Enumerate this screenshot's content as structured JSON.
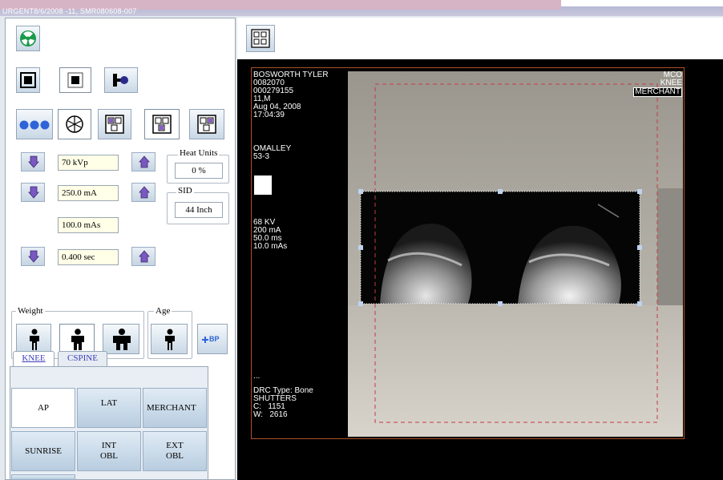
{
  "window": {
    "title": "URGENT8/6/2008 -11, SMR080608-007"
  },
  "exposure": {
    "kvp": "70 kVp",
    "ma": "250.0 mA",
    "mas": "100.0 mAs",
    "time": "0.400 sec"
  },
  "heat_units": {
    "label": "Heat Units",
    "value": "0 %"
  },
  "sid": {
    "label": "SID",
    "value": "44 Inch"
  },
  "weight_label": "Weight",
  "age_label": "Age",
  "bp_label": "BP",
  "tabs": [
    {
      "label": "KNEE",
      "selected": true
    },
    {
      "label": "CSPINE",
      "selected": false
    }
  ],
  "procedures": {
    "ap": "AP",
    "lat": "LAT",
    "merchant": "MERCHANT",
    "sunrise": "SUNRISE",
    "int_obl": [
      "INT",
      "OBL"
    ],
    "ext_obl": [
      "EXT",
      "OBL"
    ]
  },
  "overlay": {
    "patient": [
      "BOSWORTH TYLER",
      "0082070",
      "000279155",
      "11,M",
      "Aug 04, 2008",
      "17:04:39"
    ],
    "physician": [
      "OMALLEY",
      "53-3"
    ],
    "technique": [
      "68 KV",
      "200 mA",
      "50.0 ms",
      "10.0 mAs"
    ],
    "ellipsis": "...",
    "processing": [
      "DRC Type: Bone",
      "SHUTTERS",
      "C:   1151",
      "W:   2616"
    ],
    "series": [
      "MCO",
      "KNEE",
      "MERCHANT"
    ]
  },
  "colors": {
    "radiation_green": "#1a9a4a",
    "dot_blue": "#2f63d8",
    "arrow_purple": "#7a58c2",
    "tab_text": "#3d3dbb",
    "dashed_border": "#c43a44",
    "selection_handle": "#bfd2ee"
  }
}
